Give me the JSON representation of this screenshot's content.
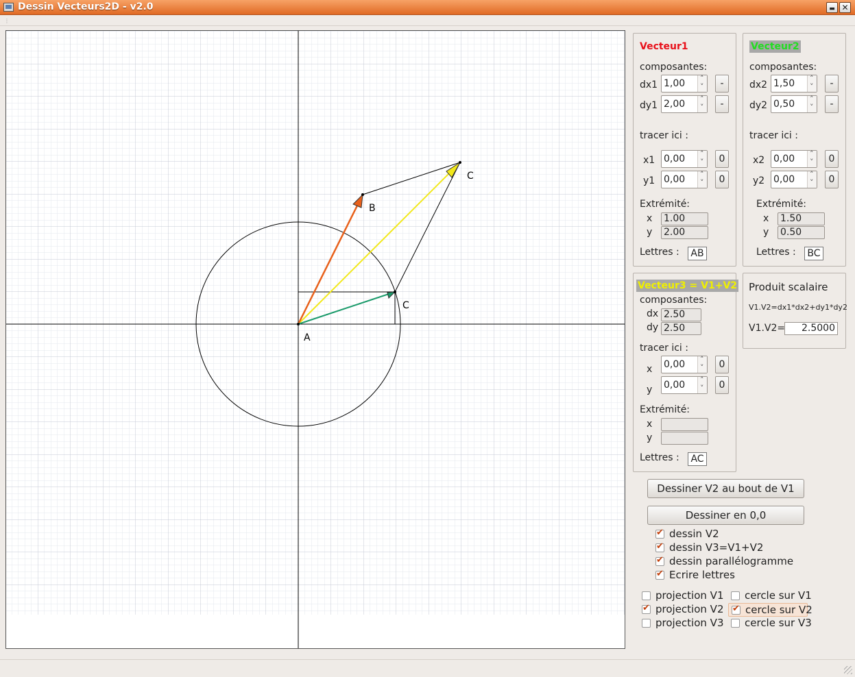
{
  "window": {
    "title": "Dessin Vecteurs2D - v2.0",
    "minimize_glyph": "▬",
    "close_glyph": "✕"
  },
  "canvas": {
    "points": {
      "A": "A",
      "B": "B",
      "C1": "C",
      "C2": "C"
    }
  },
  "vecteur1": {
    "title": "Vecteur1",
    "title_color": "#e8101a",
    "composantes_label": "composantes:",
    "dx_label": "dx1",
    "dx_value": "1,00",
    "dy_label": "dy1",
    "dy_value": "2,00",
    "neg_label": "-",
    "tracer_label": "tracer ici :",
    "x_label": "x1",
    "x_value": "0,00",
    "y_label": "y1",
    "y_value": "0,00",
    "zero_label": "0",
    "extremite_label": "Extrémité:",
    "ext_x_label": "x",
    "ext_x_value": "1.00",
    "ext_y_label": "y",
    "ext_y_value": "2.00",
    "lettres_label": "Lettres :",
    "lettres_value": "AB"
  },
  "vecteur2": {
    "title": "Vecteur2",
    "title_color": "#22dd22",
    "composantes_label": "composantes:",
    "dx_label": "dx2",
    "dx_value": "1,50",
    "dy_label": "dy2",
    "dy_value": "0,50",
    "neg_label": "-",
    "tracer_label": "tracer ici :",
    "x_label": "x2",
    "x_value": "0,00",
    "y_label": "y2",
    "y_value": "0,00",
    "zero_label": "0",
    "extremite_label": "Extrémité:",
    "ext_x_label": "x",
    "ext_x_value": "1.50",
    "ext_y_label": "y",
    "ext_y_value": "0.50",
    "lettres_label": "Lettres :",
    "lettres_value": "BC"
  },
  "vecteur3": {
    "title": "Vecteur3 = V1+V2",
    "title_color": "#f0f000",
    "composantes_label": "composantes:",
    "dx_label": "dx",
    "dx_value": "2.50",
    "dy_label": "dy",
    "dy_value": "2.50",
    "tracer_label": "tracer ici :",
    "x_label": "x",
    "x_value": "0,00",
    "y_label": "y",
    "y_value": "0,00",
    "zero_label": "0",
    "extremite_label": "Extrémité:",
    "ext_x_label": "x",
    "ext_x_value": "",
    "ext_y_label": "y",
    "ext_y_value": "",
    "lettres_label": "Lettres :",
    "lettres_value": "AC"
  },
  "produit": {
    "title": "Produit scalaire",
    "formula": "V1.V2=dx1*dx2+dy1*dy2",
    "result_label": "V1.V2=",
    "result_value": "2.5000"
  },
  "buttons": {
    "dessiner_bout": "Dessiner V2 au bout de V1",
    "dessiner_origine": "Dessiner en 0,0"
  },
  "options": [
    {
      "label": "dessin V2",
      "checked": true
    },
    {
      "label": "dessin V3=V1+V2",
      "checked": true
    },
    {
      "label": "dessin parallélogramme",
      "checked": true
    },
    {
      "label": "Ecrire lettres",
      "checked": true
    }
  ],
  "projections": [
    {
      "label": "projection V1",
      "checked": false
    },
    {
      "label": "projection V2",
      "checked": true
    },
    {
      "label": "projection V3",
      "checked": false
    }
  ],
  "cercles": [
    {
      "label": "cercle sur V1",
      "checked": false
    },
    {
      "label": "cercle sur V2",
      "checked": true
    },
    {
      "label": "cercle sur V3",
      "checked": false
    }
  ],
  "colors": {
    "v1_arrow": "#e8601a",
    "v2_arrow": "#1a9a6a",
    "v3_arrow": "#f2e81a",
    "titlebar": "#e8762e"
  }
}
